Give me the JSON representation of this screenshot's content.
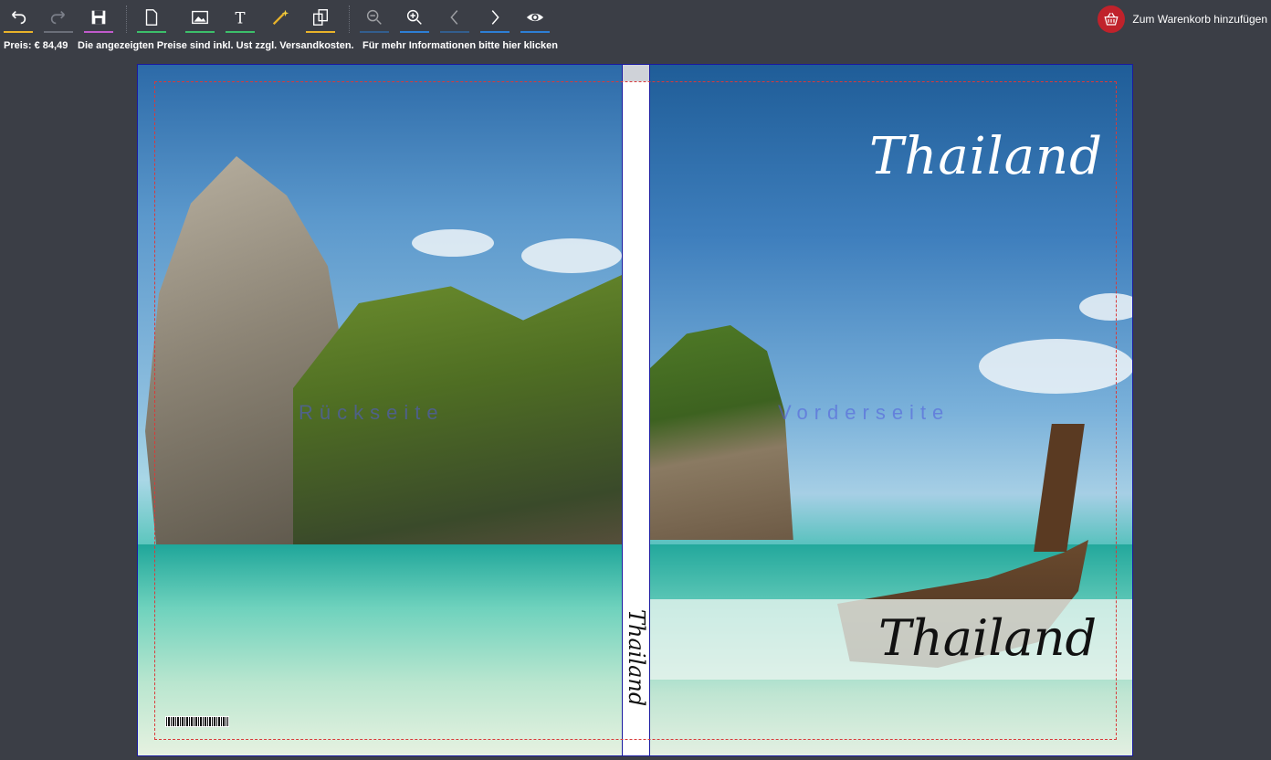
{
  "toolbar": {
    "buttons": [
      {
        "name": "undo",
        "icon": "undo-icon",
        "accent": "#e8b32a"
      },
      {
        "name": "redo",
        "icon": "redo-icon",
        "accent": "#6a6e78"
      },
      {
        "name": "save",
        "icon": "save-icon",
        "accent": "#c05acb"
      },
      {
        "name": "new-page",
        "icon": "page-icon",
        "accent": "#3cbf6a"
      },
      {
        "name": "add-image",
        "icon": "image-icon",
        "accent": "#3cbf6a"
      },
      {
        "name": "add-text",
        "icon": "text-icon",
        "accent": "#3cbf6a"
      },
      {
        "name": "magic",
        "icon": "magic-wand-icon",
        "accent": "#e8b32a"
      },
      {
        "name": "swap",
        "icon": "swap-pages-icon",
        "accent": "#e8b32a"
      },
      {
        "name": "zoom-out",
        "icon": "zoom-out-icon",
        "accent": "#2d7fd6"
      },
      {
        "name": "zoom-in",
        "icon": "zoom-in-icon",
        "accent": "#2d7fd6"
      },
      {
        "name": "prev",
        "icon": "chevron-left-icon",
        "accent": "#2d7fd6"
      },
      {
        "name": "next",
        "icon": "chevron-right-icon",
        "accent": "#2d7fd6"
      },
      {
        "name": "preview",
        "icon": "eye-icon",
        "accent": "#2d7fd6"
      }
    ],
    "cart_label": "Zum Warenkorb hinzufügen",
    "cart_color": "#c0222b"
  },
  "infobar": {
    "price": "Preis: € 84,49",
    "price_note": "Die angezeigten Preise sind inkl. Ust zzgl. Versandkosten.",
    "more_info": "Für mehr Informationen bitte hier klicken"
  },
  "cover": {
    "spine_title": "Thailand",
    "front_title_top": "Thailand",
    "front_title_bottom": "Thailand",
    "watermark_back": "Rückseite",
    "watermark_front": "Vorderseite"
  }
}
